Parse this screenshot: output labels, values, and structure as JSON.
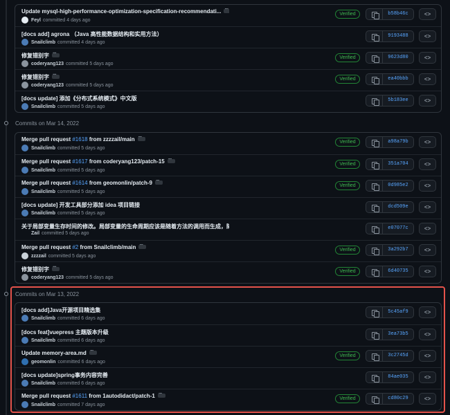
{
  "groups": [
    {
      "date_label": "",
      "commits": [
        {
          "message": "Update mysql-high-performance-optimization-specification-recommendati...",
          "pr": "",
          "suffix": "",
          "has_ellipsis": true,
          "author": "Feyl",
          "time": "committed 4 days ago",
          "verified": true,
          "sha": "b58b46c",
          "avatar_color": "#e6edf3"
        },
        {
          "message": "[docs add] agrona （Java 高性能数据结构和实用方法）",
          "pr": "",
          "suffix": "",
          "has_ellipsis": false,
          "author": "Snailclimb",
          "time": "committed 4 days ago",
          "verified": false,
          "sha": "9193488",
          "avatar_color": "#4b7bb5"
        },
        {
          "message": "修复错别字",
          "pr": "",
          "suffix": "",
          "has_ellipsis": true,
          "author": "coderyang123",
          "time": "committed 5 days ago",
          "verified": true,
          "sha": "9623d80",
          "avatar_color": "#8b949e"
        },
        {
          "message": "修复错别字",
          "pr": "",
          "suffix": "",
          "has_ellipsis": true,
          "author": "coderyang123",
          "time": "committed 5 days ago",
          "verified": true,
          "sha": "ea40bbb",
          "avatar_color": "#8b949e"
        },
        {
          "message": "[docs update] 添加《分布式系统模式》中文版",
          "pr": "",
          "suffix": "",
          "has_ellipsis": false,
          "author": "Snailclimb",
          "time": "committed 5 days ago",
          "verified": false,
          "sha": "5b183ee",
          "avatar_color": "#4b7bb5"
        }
      ]
    },
    {
      "date_label": "Commits on Mar 14, 2022",
      "commits": [
        {
          "message": "Merge pull request ",
          "pr": "#1618",
          "suffix": " from zzzzail/main",
          "has_ellipsis": true,
          "author": "Snailclimb",
          "time": "committed 5 days ago",
          "verified": true,
          "sha": "a98a79b",
          "avatar_color": "#4b7bb5"
        },
        {
          "message": "Merge pull request ",
          "pr": "#1617",
          "suffix": " from coderyang123/patch-15",
          "has_ellipsis": true,
          "author": "Snailclimb",
          "time": "committed 5 days ago",
          "verified": true,
          "sha": "351a704",
          "avatar_color": "#4b7bb5"
        },
        {
          "message": "Merge pull request ",
          "pr": "#1614",
          "suffix": " from geomonlin/patch-9",
          "has_ellipsis": true,
          "author": "Snailclimb",
          "time": "committed 5 days ago",
          "verified": true,
          "sha": "0d985e2",
          "avatar_color": "#4b7bb5"
        },
        {
          "message": "[docs update] 开发工具部分添加 idea 项目链接",
          "pr": "",
          "suffix": "",
          "has_ellipsis": false,
          "author": "Snailclimb",
          "time": "committed 5 days ago",
          "verified": false,
          "sha": "dcd509e",
          "avatar_color": "#4b7bb5"
        },
        {
          "message": "关于局部变量生存时间的修改。局部变量的生命周期应该是随着方法的调用而生成，随着方法的调用结束而消亡。",
          "pr": "",
          "suffix": "",
          "has_ellipsis": false,
          "author": "Zail",
          "time": "committed 5 days ago",
          "verified": false,
          "sha": "e07077c",
          "avatar_color": ""
        },
        {
          "message": "Merge pull request ",
          "pr": "#2",
          "suffix": " from Snailclimb/main",
          "has_ellipsis": true,
          "author": "zzzzail",
          "time": "committed 5 days ago",
          "verified": true,
          "sha": "3a292b7",
          "avatar_color": "#c9d1d9"
        },
        {
          "message": "修复错别字",
          "pr": "",
          "suffix": "",
          "has_ellipsis": true,
          "author": "coderyang123",
          "time": "committed 5 days ago",
          "verified": true,
          "sha": "6d40735",
          "avatar_color": "#8b949e"
        }
      ]
    },
    {
      "date_label": "Commits on Mar 13, 2022",
      "commits": [
        {
          "message": "[docs add]Java开源项目精选集",
          "pr": "",
          "suffix": "",
          "has_ellipsis": false,
          "author": "Snailclimb",
          "time": "committed 6 days ago",
          "verified": false,
          "sha": "5c45af9",
          "avatar_color": "#4b7bb5"
        },
        {
          "message": "[docs feat]vuepress 主题版本升级",
          "pr": "",
          "suffix": "",
          "has_ellipsis": false,
          "author": "Snailclimb",
          "time": "committed 6 days ago",
          "verified": false,
          "sha": "3ea73b5",
          "avatar_color": "#4b7bb5"
        },
        {
          "message": "Update memory-area.md",
          "pr": "",
          "suffix": "",
          "has_ellipsis": true,
          "author": "geomonlin",
          "time": "committed 6 days ago",
          "verified": true,
          "sha": "3c2745d",
          "avatar_color": "#2f6fb0"
        },
        {
          "message": "[docs update]spring事务内容完善",
          "pr": "",
          "suffix": "",
          "has_ellipsis": false,
          "author": "Snailclimb",
          "time": "committed 6 days ago",
          "verified": false,
          "sha": "84ae035",
          "avatar_color": "#4b7bb5"
        },
        {
          "message": "Merge pull request ",
          "pr": "#1611",
          "suffix": " from 1autodidact/patch-1",
          "has_ellipsis": true,
          "author": "Snailclimb",
          "time": "committed 7 days ago",
          "verified": true,
          "sha": "cd80c29",
          "avatar_color": "#4b7bb5"
        }
      ]
    }
  ],
  "labels": {
    "verified": "Verified",
    "browse": "<>"
  }
}
